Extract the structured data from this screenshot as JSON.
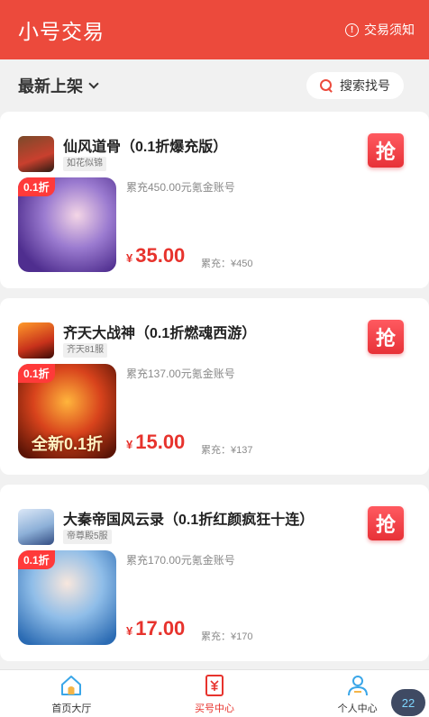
{
  "header": {
    "title": "小号交易",
    "notice_label": "交易须知",
    "notice_icon": "info-icon"
  },
  "filter": {
    "sort_label": "最新上架",
    "search_label": "搜索找号"
  },
  "listings": [
    {
      "name": "仙风道骨（0.1折爆充版）",
      "server": "如花似锦",
      "grab": "抢",
      "cover_tag": "0.1折",
      "desc": "累充450.00元氪金账号",
      "price_symbol": "¥",
      "price": "35.00",
      "cumulative": "累充：¥450"
    },
    {
      "name": "齐天大战神（0.1折燃魂西游）",
      "server": "齐天81服",
      "grab": "抢",
      "cover_tag": "0.1折",
      "cover_text": "全新0.1折",
      "desc": "累充137.00元氪金账号",
      "price_symbol": "¥",
      "price": "15.00",
      "cumulative": "累充：¥137"
    },
    {
      "name": "大秦帝国风云录（0.1折红颜疯狂十连）",
      "server": "帝尊殿5服",
      "grab": "抢",
      "cover_tag": "0.1折",
      "desc": "累充170.00元氪金账号",
      "price_symbol": "¥",
      "price": "17.00",
      "cumulative": "累充：¥170"
    }
  ],
  "tabbar": [
    {
      "label": "首页大厅",
      "icon": "home-icon"
    },
    {
      "label": "买号中心",
      "icon": "receipt-icon",
      "active": true
    },
    {
      "label": "个人中心",
      "icon": "user-icon"
    }
  ],
  "badge": "22",
  "colors": {
    "brand": "#ec4a3c",
    "price": "#e7332d",
    "background": "#f1f1f1"
  }
}
